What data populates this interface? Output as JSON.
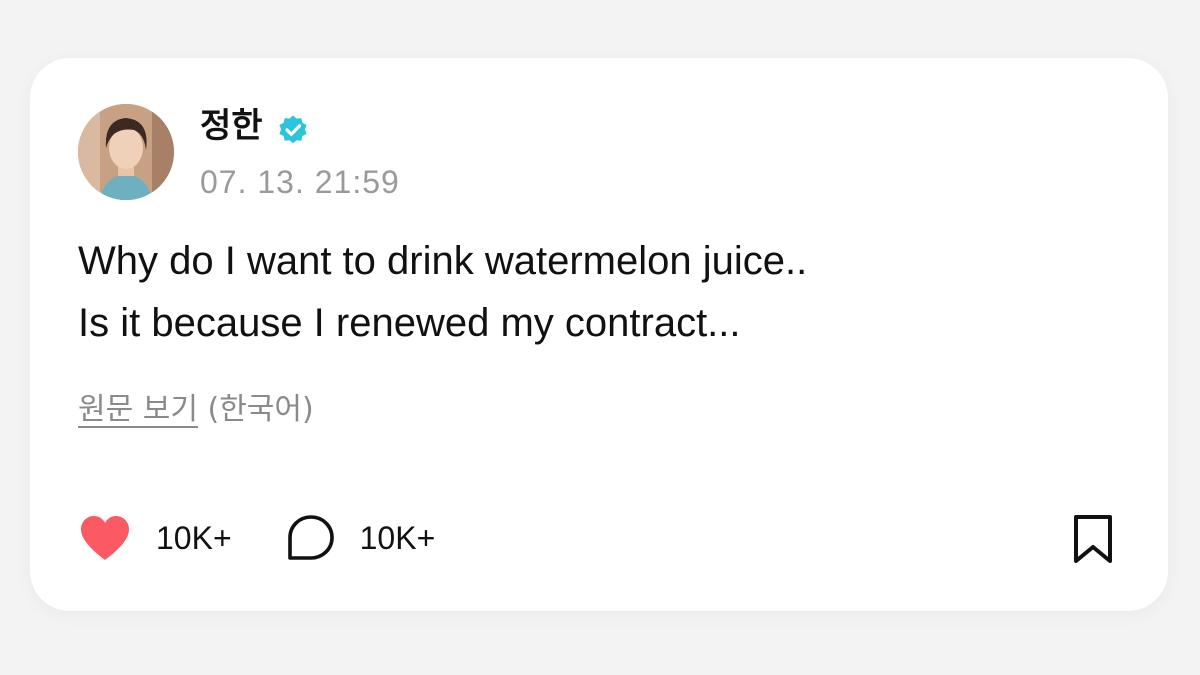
{
  "post": {
    "author_name": "정한",
    "verified": true,
    "timestamp": "07. 13. 21:59",
    "body_lines": [
      "Why do I want to drink watermelon juice..",
      "Is it because I renewed my contract..."
    ],
    "translation": {
      "view_original_label": "원문 보기",
      "language_label": "(한국어)"
    },
    "actions": {
      "like_count": "10K+",
      "comment_count": "10K+"
    }
  },
  "icons": {
    "like": "heart-icon",
    "comment": "comment-bubble-icon",
    "bookmark": "bookmark-icon",
    "verified": "verified-badge-icon"
  },
  "colors": {
    "like_heart": "#fb5a63",
    "verified_badge": "#2cc4da",
    "timestamp_text": "#9a9a9a",
    "card_background": "#ffffff",
    "page_background": "#f3f3f3"
  }
}
